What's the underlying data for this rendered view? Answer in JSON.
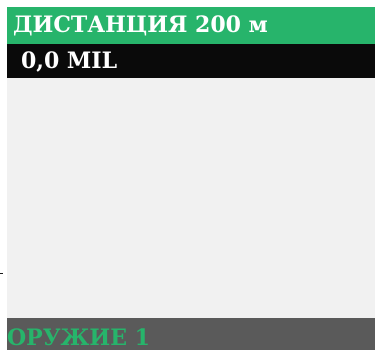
{
  "header": {
    "title": "ДИСТАНЦИЯ 200 м"
  },
  "readout": {
    "value": "0,0 MIL"
  },
  "footer": {
    "label": "ОРУЖИЕ 1"
  },
  "colors": {
    "accent_green": "#27b46b",
    "readout_bg": "#0a0a0a",
    "panel_bg": "#f1f1f1",
    "footer_bg": "#5a5a5a"
  }
}
